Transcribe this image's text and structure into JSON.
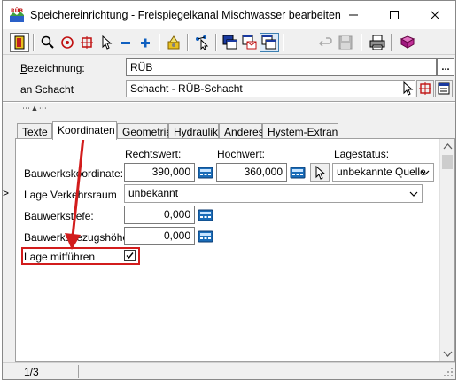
{
  "window": {
    "title": "Speichereinrichtung - Freispiegelkanal Mischwasser bearbeiten",
    "app_icon_text": "RÜB"
  },
  "header": {
    "bezeichnung_label_key": "B",
    "bezeichnung_label_rest": "ezeichnung:",
    "bezeichnung_value": "RÜB",
    "bezeichnung_button": "...",
    "schacht_label": "an Schacht",
    "schacht_value": "Schacht - RÜB-Schacht"
  },
  "splitter_glyph": "⋯ ▲ ⋯",
  "tabs": [
    "Texte",
    "Koordinaten",
    "Geometrie",
    "Hydraulik",
    "Anderes",
    "Hystem-Extran"
  ],
  "active_tab": "Koordinaten",
  "columns": {
    "rechtswert": "Rechtswert:",
    "hochwert": "Hochwert:",
    "lagestatus": "Lagestatus:"
  },
  "rows": {
    "bauwerkskoordinate_label": "Bauwerkskoordinate:",
    "rechtswert_value": "390,000",
    "hochwert_value": "360,000",
    "lagestatus_value": "unbekannte Quelle",
    "lage_verkehrsraum_label": "Lage Verkehrsraum",
    "lage_verkehrsraum_value": "unbekannt",
    "bauwerkstiefe_label": "Bauwerkstiefe:",
    "bauwerkstiefe_value": "0,000",
    "bauwerksbezugshoehe_label": "Bauwerksbezugshöhe:",
    "bauwerksbezugshoehe_value": "0,000",
    "lage_mitfuehren_label": "Lage mitführen",
    "lage_mitfuehren_checked": true
  },
  "row_marker": ">",
  "status": {
    "record_position": "1/3"
  },
  "colors": {
    "highlight_red": "#d21c1c",
    "icon_blue": "#1060c0",
    "window_bg": "#f0f0f0"
  }
}
